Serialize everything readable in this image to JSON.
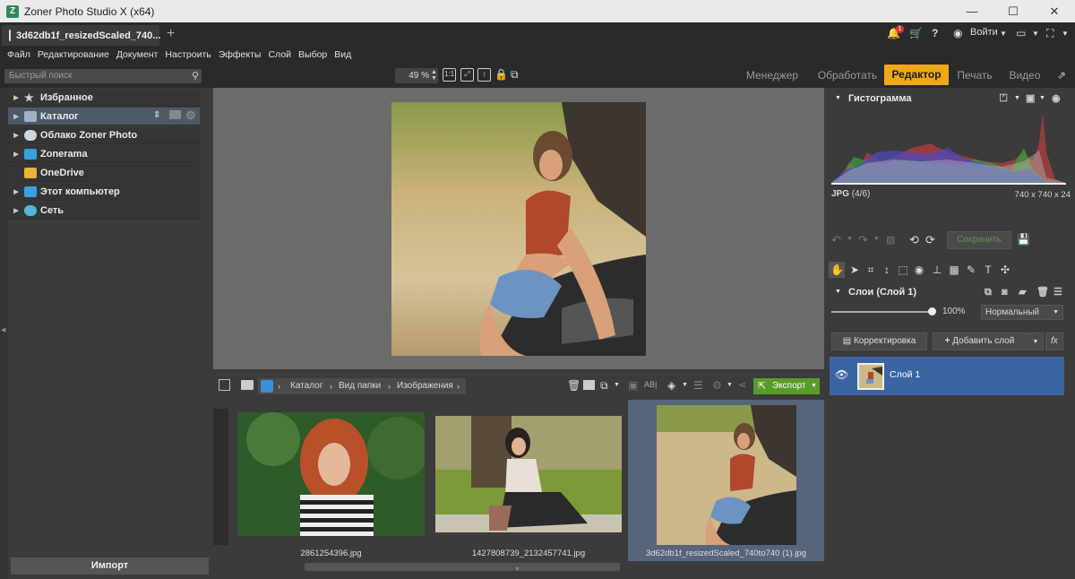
{
  "window": {
    "title": "Zoner Photo Studio X (x64)",
    "minimize": "—",
    "maximize": "☐",
    "close": "✕"
  },
  "tabbar": {
    "doc_tab": "3d62db1f_resizedScaled_740...",
    "new_tab": "+",
    "notifications_badge": "1",
    "login_label": "Войти"
  },
  "menu": {
    "items": [
      "Файл",
      "Редактирование",
      "Документ",
      "Настроить",
      "Эффекты",
      "Слой",
      "Выбор",
      "Вид"
    ]
  },
  "toolbar": {
    "search_placeholder": "Быстрый поиск",
    "zoom_value": "49 %",
    "modes": [
      "Менеджер",
      "Обработать",
      "Редактор",
      "Печать",
      "Видео"
    ],
    "active_mode": "Редактор"
  },
  "navigator": {
    "items": [
      {
        "label": "Избранное",
        "icon": "star-icon",
        "color": "#cfcfcf"
      },
      {
        "label": "Каталог",
        "icon": "catalog-icon",
        "color": "#9fb3c8"
      },
      {
        "label": "Облако Zoner Photo",
        "icon": "cloud-icon",
        "color": "#cfd8e0"
      },
      {
        "label": "Zonerama",
        "icon": "zonerama-icon",
        "color": "#3aa0e0"
      },
      {
        "label": "OneDrive",
        "icon": "folder-icon",
        "color": "#e8b33a"
      },
      {
        "label": "Этот компьютер",
        "icon": "computer-icon",
        "color": "#3aa0e0"
      },
      {
        "label": "Сеть",
        "icon": "network-icon",
        "color": "#4fb7d9"
      }
    ],
    "import_label": "Импорт"
  },
  "browser": {
    "breadcrumb": [
      "Каталог",
      "Вид папки",
      "Изображения"
    ],
    "export_label": "Экспорт",
    "files": [
      {
        "name": "2861254396.jpg"
      },
      {
        "name": "1427808739_2132457741.jpg"
      },
      {
        "name": "3d62db1f_resizedScaled_740to740 (1).jpg"
      }
    ]
  },
  "histogram": {
    "title": "Гистограмма",
    "format": "JPG",
    "counter": "(4/6)",
    "dimensions": "740 x 740 x 24"
  },
  "edit": {
    "save_label": "Сохранить"
  },
  "layers": {
    "title": "Слои (Слой 1)",
    "opacity": "100%",
    "opacity_fraction": 1.0,
    "blend_mode": "Нормальный",
    "adjust_label": "Корректировка",
    "add_layer_label": "Добавить слой",
    "fx_label": "fx",
    "items": [
      {
        "name": "Слой 1"
      }
    ]
  },
  "colors": {
    "accent": "#f0a81a",
    "selection": "#3b64a3",
    "export_green": "#5a9a2a"
  }
}
